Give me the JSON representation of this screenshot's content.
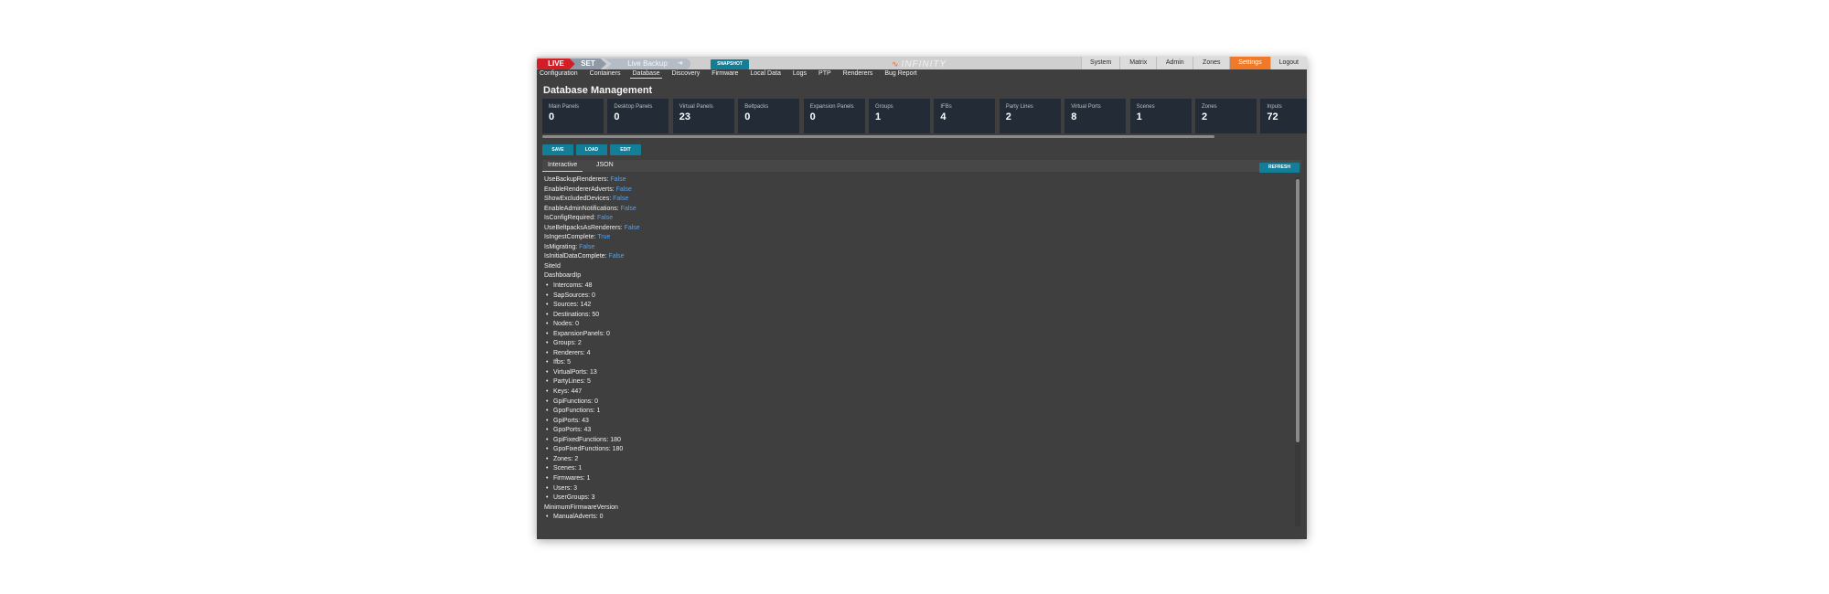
{
  "modes": {
    "live": "LIVE",
    "set": "SET",
    "backup": "Live Backup"
  },
  "snapshot_label": "SNAPSHOT",
  "brand": "INFINITY",
  "top_nav": [
    "System",
    "Matrix",
    "Admin",
    "Zones",
    "Settings",
    "Logout"
  ],
  "top_nav_active": "Settings",
  "sub_nav": [
    "Configuration",
    "Containers",
    "Database",
    "Discovery",
    "Firmware",
    "Local Data",
    "Logs",
    "PTP",
    "Renderers",
    "Bug Report"
  ],
  "sub_nav_active": "Database",
  "page_title": "Database Management",
  "stats": [
    {
      "label": "Main Panels",
      "value": "0"
    },
    {
      "label": "Desktop Panels",
      "value": "0"
    },
    {
      "label": "Virtual Panels",
      "value": "23"
    },
    {
      "label": "Beltpacks",
      "value": "0"
    },
    {
      "label": "Expansion Panels",
      "value": "0"
    },
    {
      "label": "Groups",
      "value": "1"
    },
    {
      "label": "IFBs",
      "value": "4"
    },
    {
      "label": "Party Lines",
      "value": "2"
    },
    {
      "label": "Virtual Ports",
      "value": "8"
    },
    {
      "label": "Scenes",
      "value": "1"
    },
    {
      "label": "Zones",
      "value": "2"
    },
    {
      "label": "Inputs",
      "value": "72"
    }
  ],
  "actions": {
    "save": "SAVE",
    "load": "LOAD",
    "edit": "EDIT"
  },
  "tabs": {
    "interactive": "Interactive",
    "json": "JSON"
  },
  "refresh_label": "REFRESH",
  "settings": [
    {
      "key": "UseBackupRenderers:",
      "value": "False"
    },
    {
      "key": "EnableRendererAdverts:",
      "value": "False"
    },
    {
      "key": "ShowExcludedDevices:",
      "value": "False"
    },
    {
      "key": "EnableAdminNotifications:",
      "value": "False"
    },
    {
      "key": "IsConfigRequired:",
      "value": "False"
    },
    {
      "key": "UseBeltpacksAsRenderers:",
      "value": "False"
    },
    {
      "key": "IsIngestComplete:",
      "value": "True"
    },
    {
      "key": "IsMigrating:",
      "value": "False"
    },
    {
      "key": "IsInitialDataComplete:",
      "value": "False"
    }
  ],
  "site_id_label": "SiteId",
  "dashboard_label": "DashboardIp",
  "dashboard_items": [
    "Intercoms: 48",
    "SapSources: 0",
    "Sources: 142",
    "Destinations: 50",
    "Nodes: 0",
    "ExpansionPanels: 0",
    "Groups: 2",
    "Renderers: 4",
    "Ifbs: 5",
    "VirtualPorts: 13",
    "PartyLines: 5",
    "Keys: 447",
    "GpiFunctions: 0",
    "GpoFunctions: 1",
    "GpiPorts: 43",
    "GpoPorts: 43",
    "GpiFixedFunctions: 180",
    "GpoFixedFunctions: 180",
    "Zones: 2",
    "Scenes: 1",
    "Firmwares: 1",
    "Users: 3",
    "UserGroups: 3"
  ],
  "min_firmware_label": "MinimumFirmwareVersion",
  "min_firmware_items": [
    "ManualAdverts: 0"
  ]
}
